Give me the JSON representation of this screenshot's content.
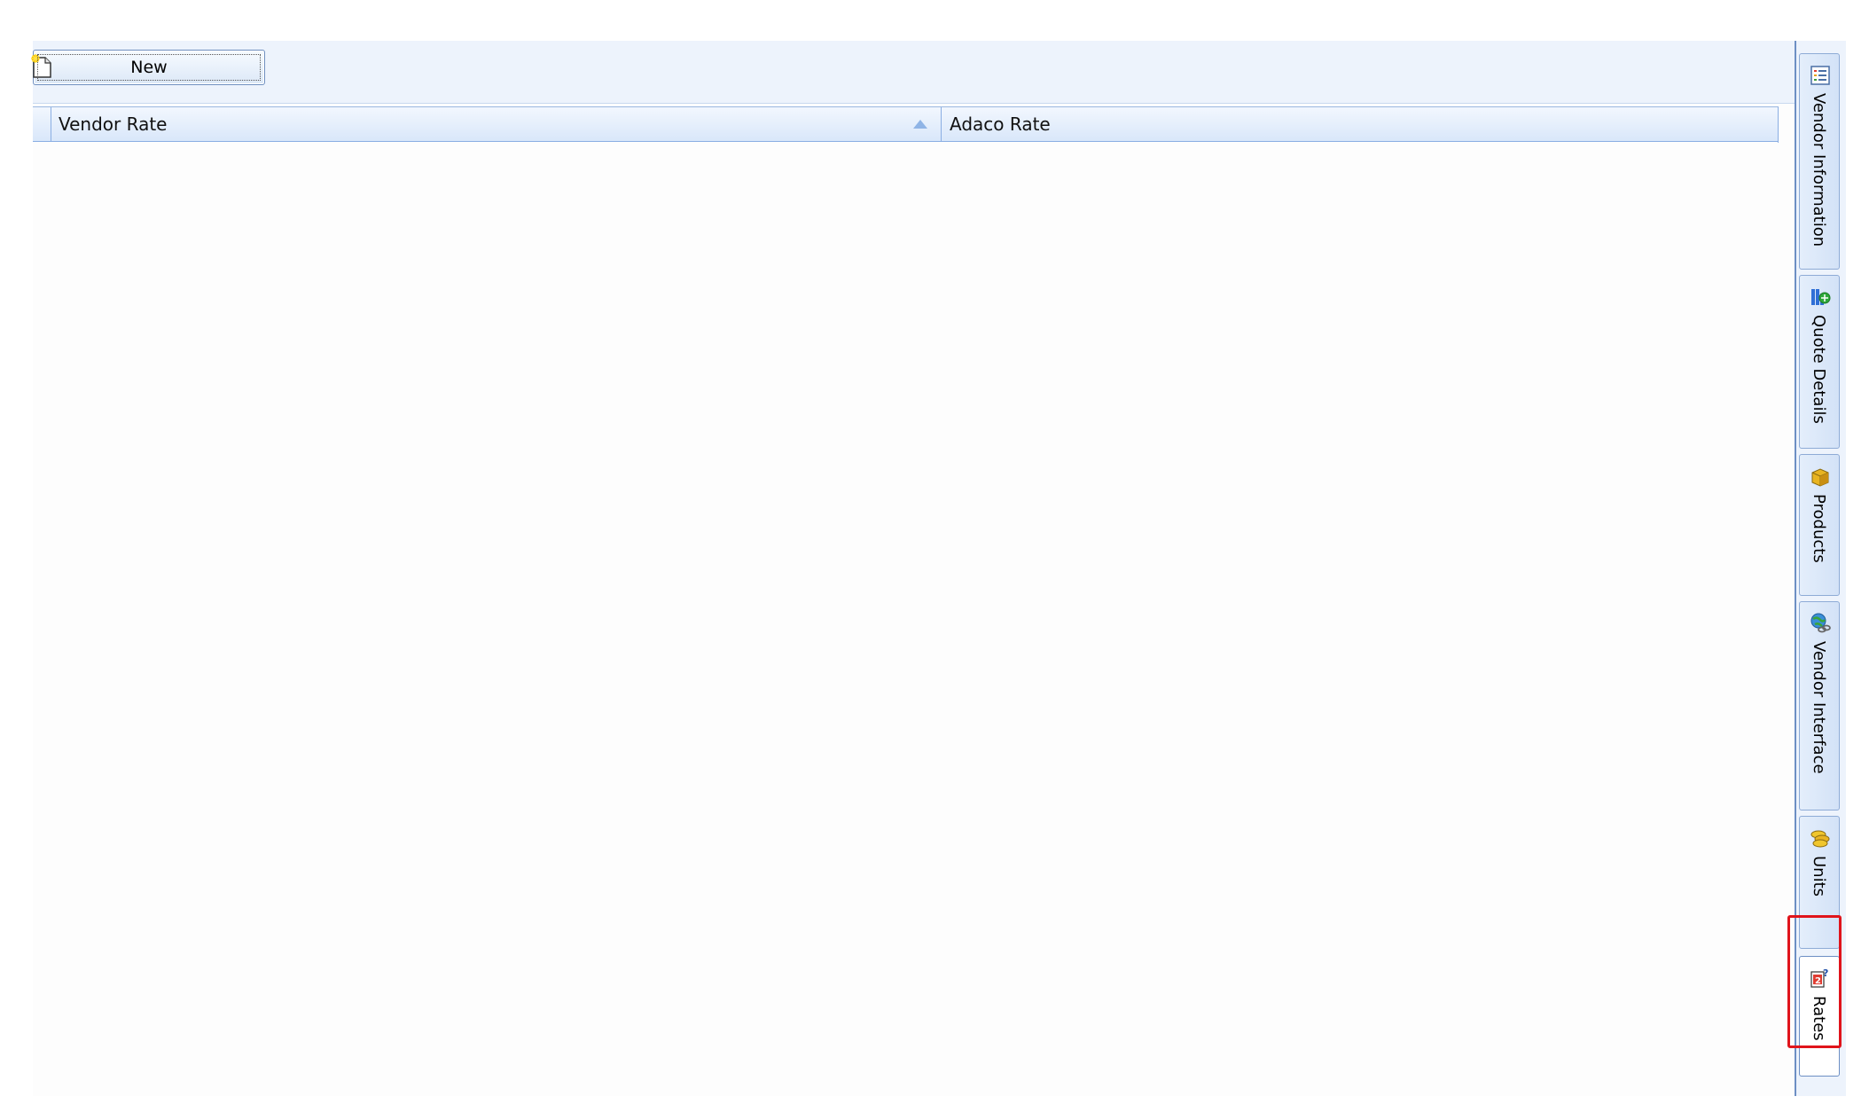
{
  "toolbar": {
    "new_label": "New"
  },
  "grid": {
    "columns": [
      {
        "label": "Vendor Rate",
        "sorted": "ascending"
      },
      {
        "label": "Adaco Rate"
      }
    ],
    "rows": []
  },
  "tabs": [
    {
      "label": "Vendor Information",
      "icon": "list-icon"
    },
    {
      "label": "Quote Details",
      "icon": "quote-details-icon"
    },
    {
      "label": "Products",
      "icon": "box-icon"
    },
    {
      "label": "Vendor Interface",
      "icon": "globe-link-icon"
    },
    {
      "label": "Units",
      "icon": "coins-icon"
    },
    {
      "label": "Rates",
      "icon": "rates-icon",
      "active": true
    }
  ],
  "colors": {
    "header_border": "#8aaee3",
    "panel_bg": "#edf3fc",
    "highlight": "#e0141b"
  }
}
